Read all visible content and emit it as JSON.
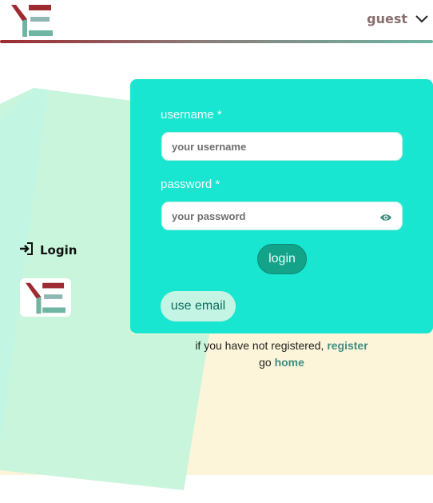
{
  "header": {
    "user_name": "guest",
    "logo_icon": "ye-logo-icon",
    "menu_icon": "chevron-down-icon"
  },
  "side": {
    "title": "Login",
    "icon": "sign-in-icon"
  },
  "form": {
    "username_label": "username *",
    "username_placeholder": "your username",
    "password_label": "password *",
    "password_placeholder": "your password",
    "toggle_icon": "eye-icon",
    "login_label": "login",
    "email_label": "use email"
  },
  "footer": {
    "register_prefix": "if you have not registered, ",
    "register_link": "register",
    "home_prefix": "go ",
    "home_link": "home"
  },
  "colors": {
    "card": "#19e6d1",
    "accent_red": "#9e2b31",
    "accent_teal": "#6fb5a4",
    "background_yellow": "#fdf5da",
    "background_green": "#c8f5dc"
  }
}
